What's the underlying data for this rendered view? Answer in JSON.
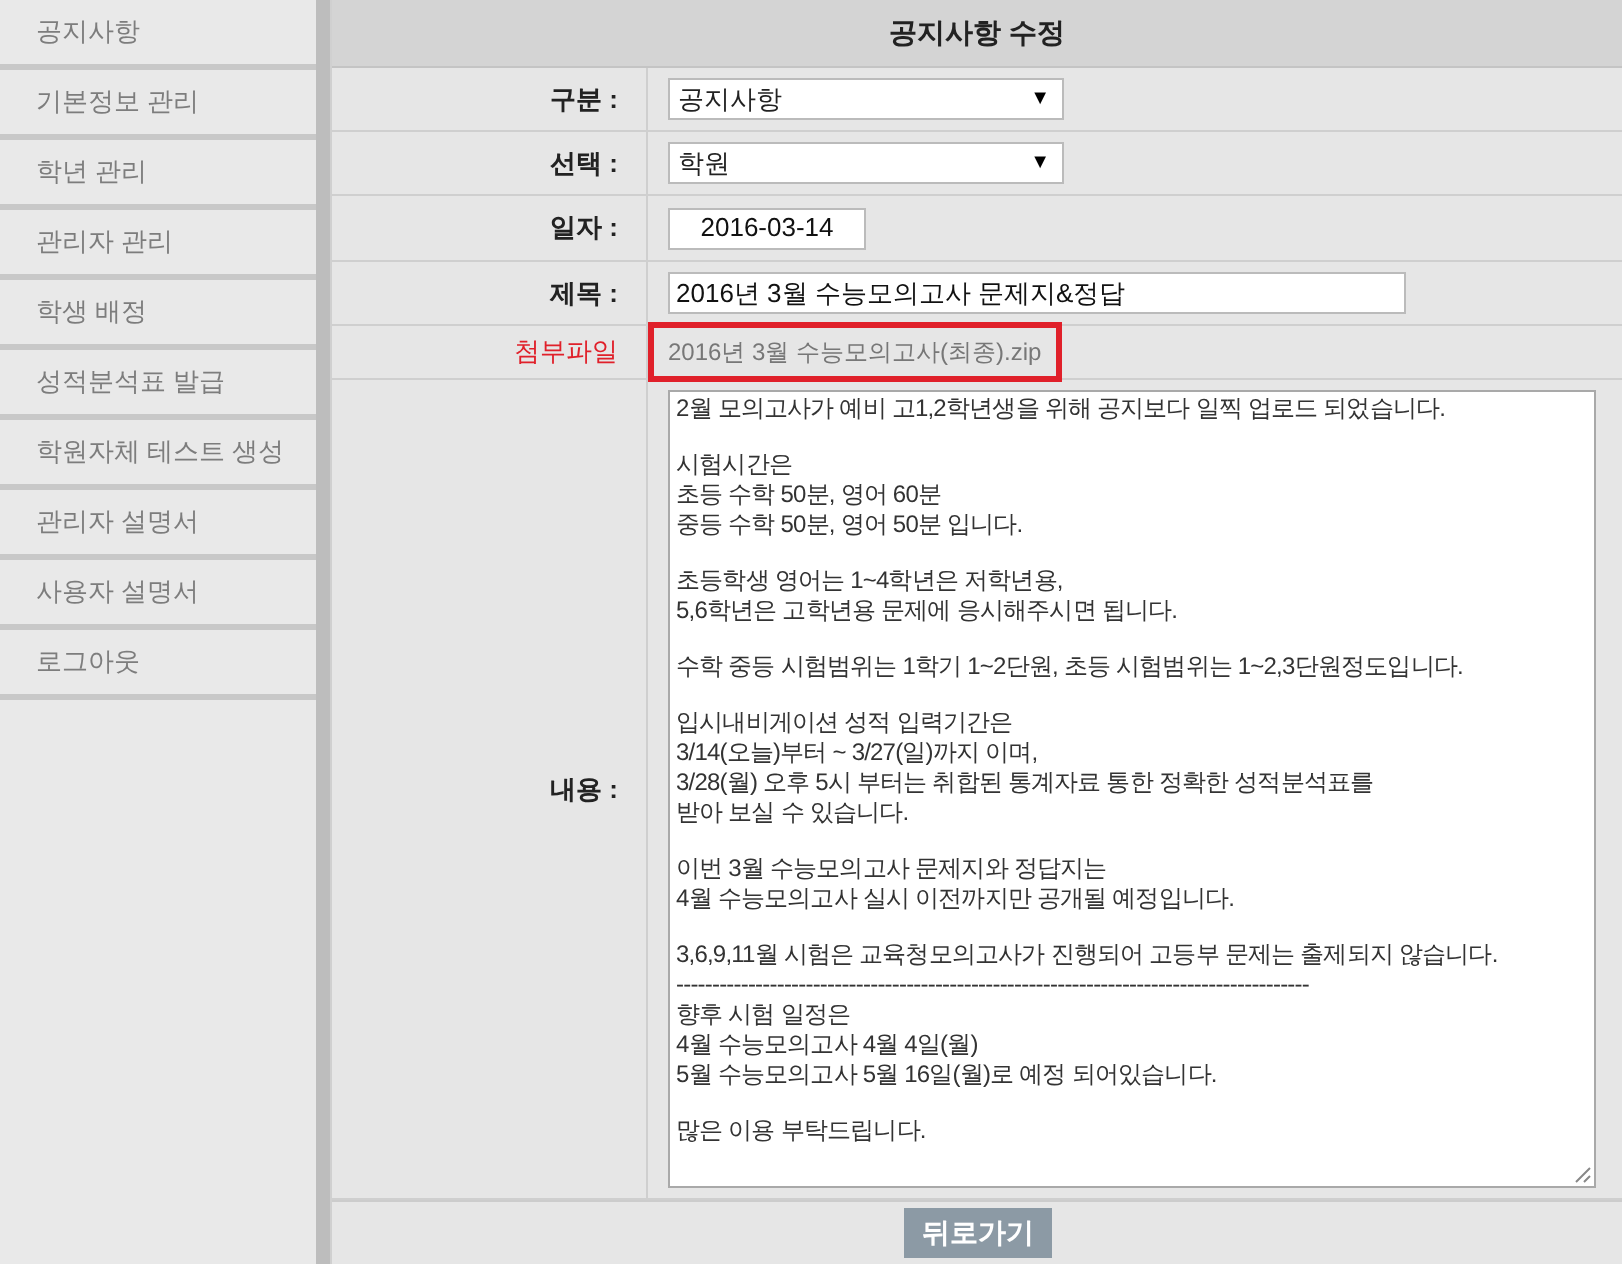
{
  "sidebar": {
    "items": [
      {
        "label": "공지사항"
      },
      {
        "label": "기본정보 관리"
      },
      {
        "label": "학년 관리"
      },
      {
        "label": "관리자 관리"
      },
      {
        "label": "학생 배정"
      },
      {
        "label": "성적분석표 발급"
      },
      {
        "label": "학원자체 테스트 생성"
      },
      {
        "label": "관리자 설명서"
      },
      {
        "label": "사용자 설명서"
      },
      {
        "label": "로그아웃"
      }
    ]
  },
  "form": {
    "title": "공지사항 수정",
    "fields": [
      {
        "kind": "select",
        "label": "구분 :",
        "value": "공지사항",
        "arrow": "▼"
      },
      {
        "kind": "select",
        "label": "선택 :",
        "value": "학원",
        "arrow": "▼"
      },
      {
        "kind": "date",
        "label": "일자 :",
        "value": "2016-03-14"
      },
      {
        "kind": "text",
        "label": "제목 :",
        "value": "2016년 3월 수능모의고사 문제지&정답"
      },
      {
        "kind": "attachment",
        "label": "첨부파일",
        "value": "2016년 3월 수능모의고사(최종).zip",
        "highlighted": true
      },
      {
        "kind": "content",
        "label": "내용 :",
        "paragraphs": [
          "2월 모의고사가 예비 고1,2학년생을 위해 공지보다 일찍 업로드 되었습니다.",
          "시험시간은\n초등 수학 50분, 영어 60분\n중등 수학 50분, 영어 50분 입니다.",
          "초등학생 영어는 1~4학년은 저학년용,\n5,6학년은 고학년용 문제에 응시해주시면 됩니다.",
          "수학 중등 시험범위는 1학기 1~2단원, 초등 시험범위는 1~2,3단원정도입니다.",
          "입시내비게이션 성적 입력기간은\n3/14(오늘)부터 ~ 3/27(일)까지 이며,\n3/28(월) 오후 5시 부터는 취합된 통계자료 통한 정확한 성적분석표를\n받아 보실 수 있습니다.",
          "이번 3월 수능모의고사 문제지와 정답지는\n4월 수능모의고사 실시 이전까지만 공개될 예정입니다.",
          "3,6,9,11월 시험은 교육청모의고사가 진행되어 고등부 문제는 출제되지 않습니다.\n----------------------------------------------------------------------------------------\n향후 시험 일정은\n4월 수능모의고사 4월 4일(월)\n5월 수능모의고사 5월 16일(월)로 예정 되어있습니다.",
          "많은 이용 부탁드립니다."
        ]
      }
    ],
    "back_button": "뒤로가기"
  }
}
